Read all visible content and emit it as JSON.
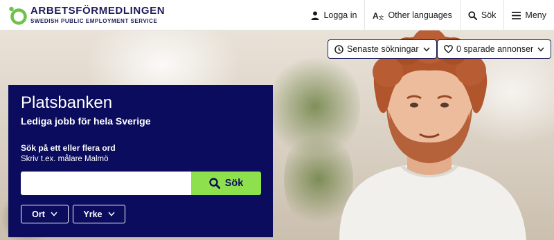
{
  "brand": {
    "name": "ARBETSFÖRMEDLINGEN",
    "subtitle": "SWEDISH PUBLIC EMPLOYMENT SERVICE",
    "logo_color": "#6cc24a",
    "text_color": "#1c1c5a"
  },
  "nav": {
    "login": {
      "label": "Logga in",
      "icon": "person-icon"
    },
    "languages": {
      "label": "Other languages",
      "icon": "translate-icon"
    },
    "search": {
      "label": "Sök",
      "icon": "search-icon"
    },
    "menu": {
      "label": "Meny",
      "icon": "hamburger-icon"
    }
  },
  "saved": {
    "recent_searches": {
      "label": "Senaste sökningar",
      "icon": "clock-icon"
    },
    "saved_ads": {
      "label": "0 sparade annonser",
      "icon": "heart-icon"
    }
  },
  "search_card": {
    "title": "Platsbanken",
    "subtitle": "Lediga jobb för hela Sverige",
    "field_label": "Sök på ett eller flera ord",
    "field_hint": "Skriv t.ex. målare Malmö",
    "input_value": "",
    "button_label": "Sök",
    "background": "#0c0c5e",
    "button_color": "#8ee04c",
    "filters": [
      {
        "label": "Ort"
      },
      {
        "label": "Yrke"
      }
    ]
  }
}
